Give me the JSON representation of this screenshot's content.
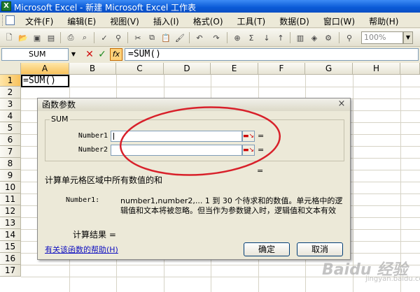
{
  "window": {
    "title": "Microsoft Excel - 新建 Microsoft Excel 工作表",
    "app_icon": "excel-icon"
  },
  "menu": {
    "items": [
      "文件(F)",
      "编辑(E)",
      "视图(V)",
      "插入(I)",
      "格式(O)",
      "工具(T)",
      "数据(D)",
      "窗口(W)",
      "帮助(H)"
    ]
  },
  "toolbar": {
    "zoom": "100%"
  },
  "formula_bar": {
    "name_box": "SUM",
    "fx_label": "fx",
    "formula": "=SUM()"
  },
  "grid": {
    "columns": [
      "A",
      "B",
      "C",
      "D",
      "E",
      "F",
      "G",
      "H"
    ],
    "rows": [
      "1",
      "2",
      "3",
      "4",
      "5",
      "6",
      "7",
      "8",
      "9",
      "10",
      "11",
      "12",
      "13",
      "14",
      "15",
      "16",
      "17"
    ],
    "active_cell_value": "=SUM()"
  },
  "dialog": {
    "title": "函数参数",
    "close": "×",
    "function_name": "SUM",
    "args": [
      {
        "label": "Number1",
        "equals": "="
      },
      {
        "label": "Number2",
        "equals": "="
      }
    ],
    "result_equals": "=",
    "description": "计算单元格区域中所有数值的和",
    "arg_name": "Number1:",
    "arg_description": "number1,number2,... 1 到 30 个待求和的数值。单元格中的逻辑值和文本将被忽略。但当作为参数键入时，逻辑值和文本有效",
    "result_label": "计算结果 =",
    "help_link": "有关该函数的帮助(H)",
    "ok": "确定",
    "cancel": "取消"
  },
  "watermark": {
    "main": "Baidu 经验",
    "sub": "jingyan.baidu.com"
  },
  "colors": {
    "title_bar": "#0a5ad6",
    "annotation": "#d8202a",
    "link": "#1010c0"
  }
}
